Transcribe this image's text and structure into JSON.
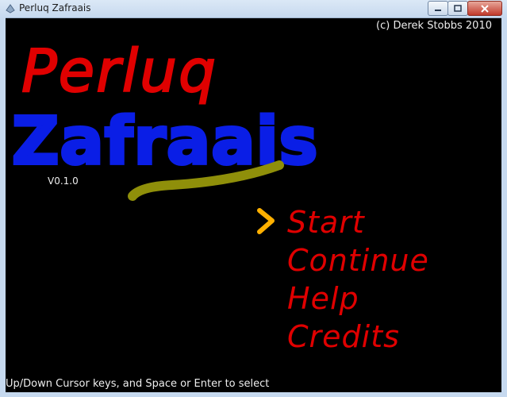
{
  "window": {
    "title": "Perluq Zafraais"
  },
  "game": {
    "copyright": "(c) Derek Stobbs 2010",
    "logo_line1": "Perluq",
    "logo_line2": "Zafraais",
    "version": "V0.1.0",
    "menu": [
      {
        "label": "Start",
        "selected": true
      },
      {
        "label": "Continue",
        "selected": false
      },
      {
        "label": "Help",
        "selected": false
      },
      {
        "label": "Credits",
        "selected": false
      }
    ],
    "instructions": "Up/Down Cursor keys, and Space or Enter to select"
  },
  "colors": {
    "background": "#000000",
    "logo_line1": "#e00000",
    "logo_line2": "#0a1ee6",
    "underline": "#8f8f0a",
    "menu_text": "#e00000",
    "cursor": "#ffb000",
    "caption_text": "#ededed"
  },
  "icons": [
    "app-icon",
    "minimize-icon",
    "maximize-icon",
    "close-icon",
    "menu-cursor-icon"
  ]
}
